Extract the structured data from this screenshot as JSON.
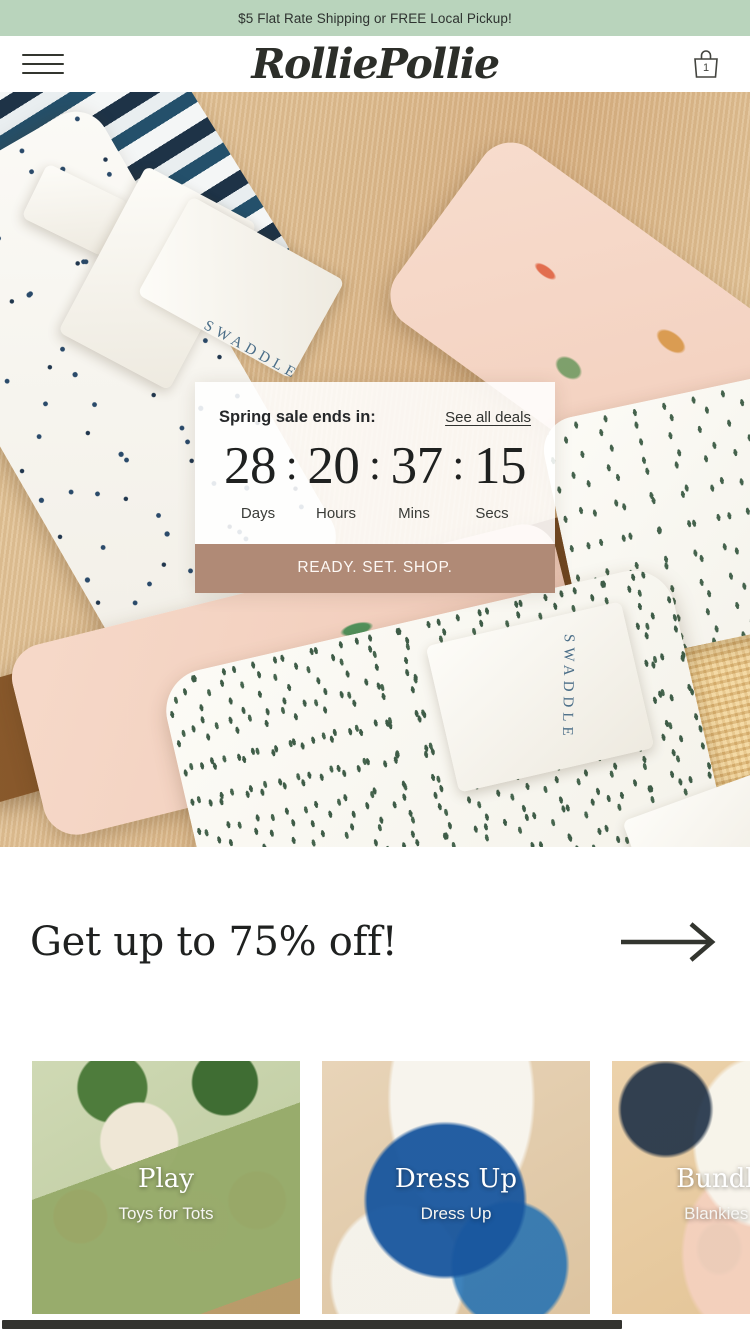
{
  "announcement": {
    "text": "$5 Flat Rate Shipping or FREE Local Pickup!",
    "background_color": "#b9d4bc"
  },
  "header": {
    "menu_icon": "hamburger-menu-icon",
    "brand": "RolliePollie",
    "cart_icon": "shopping-bag-icon",
    "cart_count": "1"
  },
  "hero": {
    "countdown": {
      "title": "Spring sale ends in:",
      "link_label": "See all deals",
      "units": [
        {
          "value": "28",
          "label": "Days"
        },
        {
          "value": "20",
          "label": "Hours"
        },
        {
          "value": "37",
          "label": "Mins"
        },
        {
          "value": "15",
          "label": "Secs"
        }
      ],
      "separator": ":",
      "cta_label": "READY. SET. SHOP.",
      "cta_color": "#b08a76"
    }
  },
  "promo": {
    "heading": "Get up to 75% off!",
    "arrow_icon": "arrow-right-icon"
  },
  "categories": [
    {
      "title": "Play",
      "subtitle": "Toys for Tots"
    },
    {
      "title": "Dress Up",
      "subtitle": "Dress Up"
    },
    {
      "title": "Bundle Up",
      "subtitle": "Blankies & More"
    }
  ]
}
